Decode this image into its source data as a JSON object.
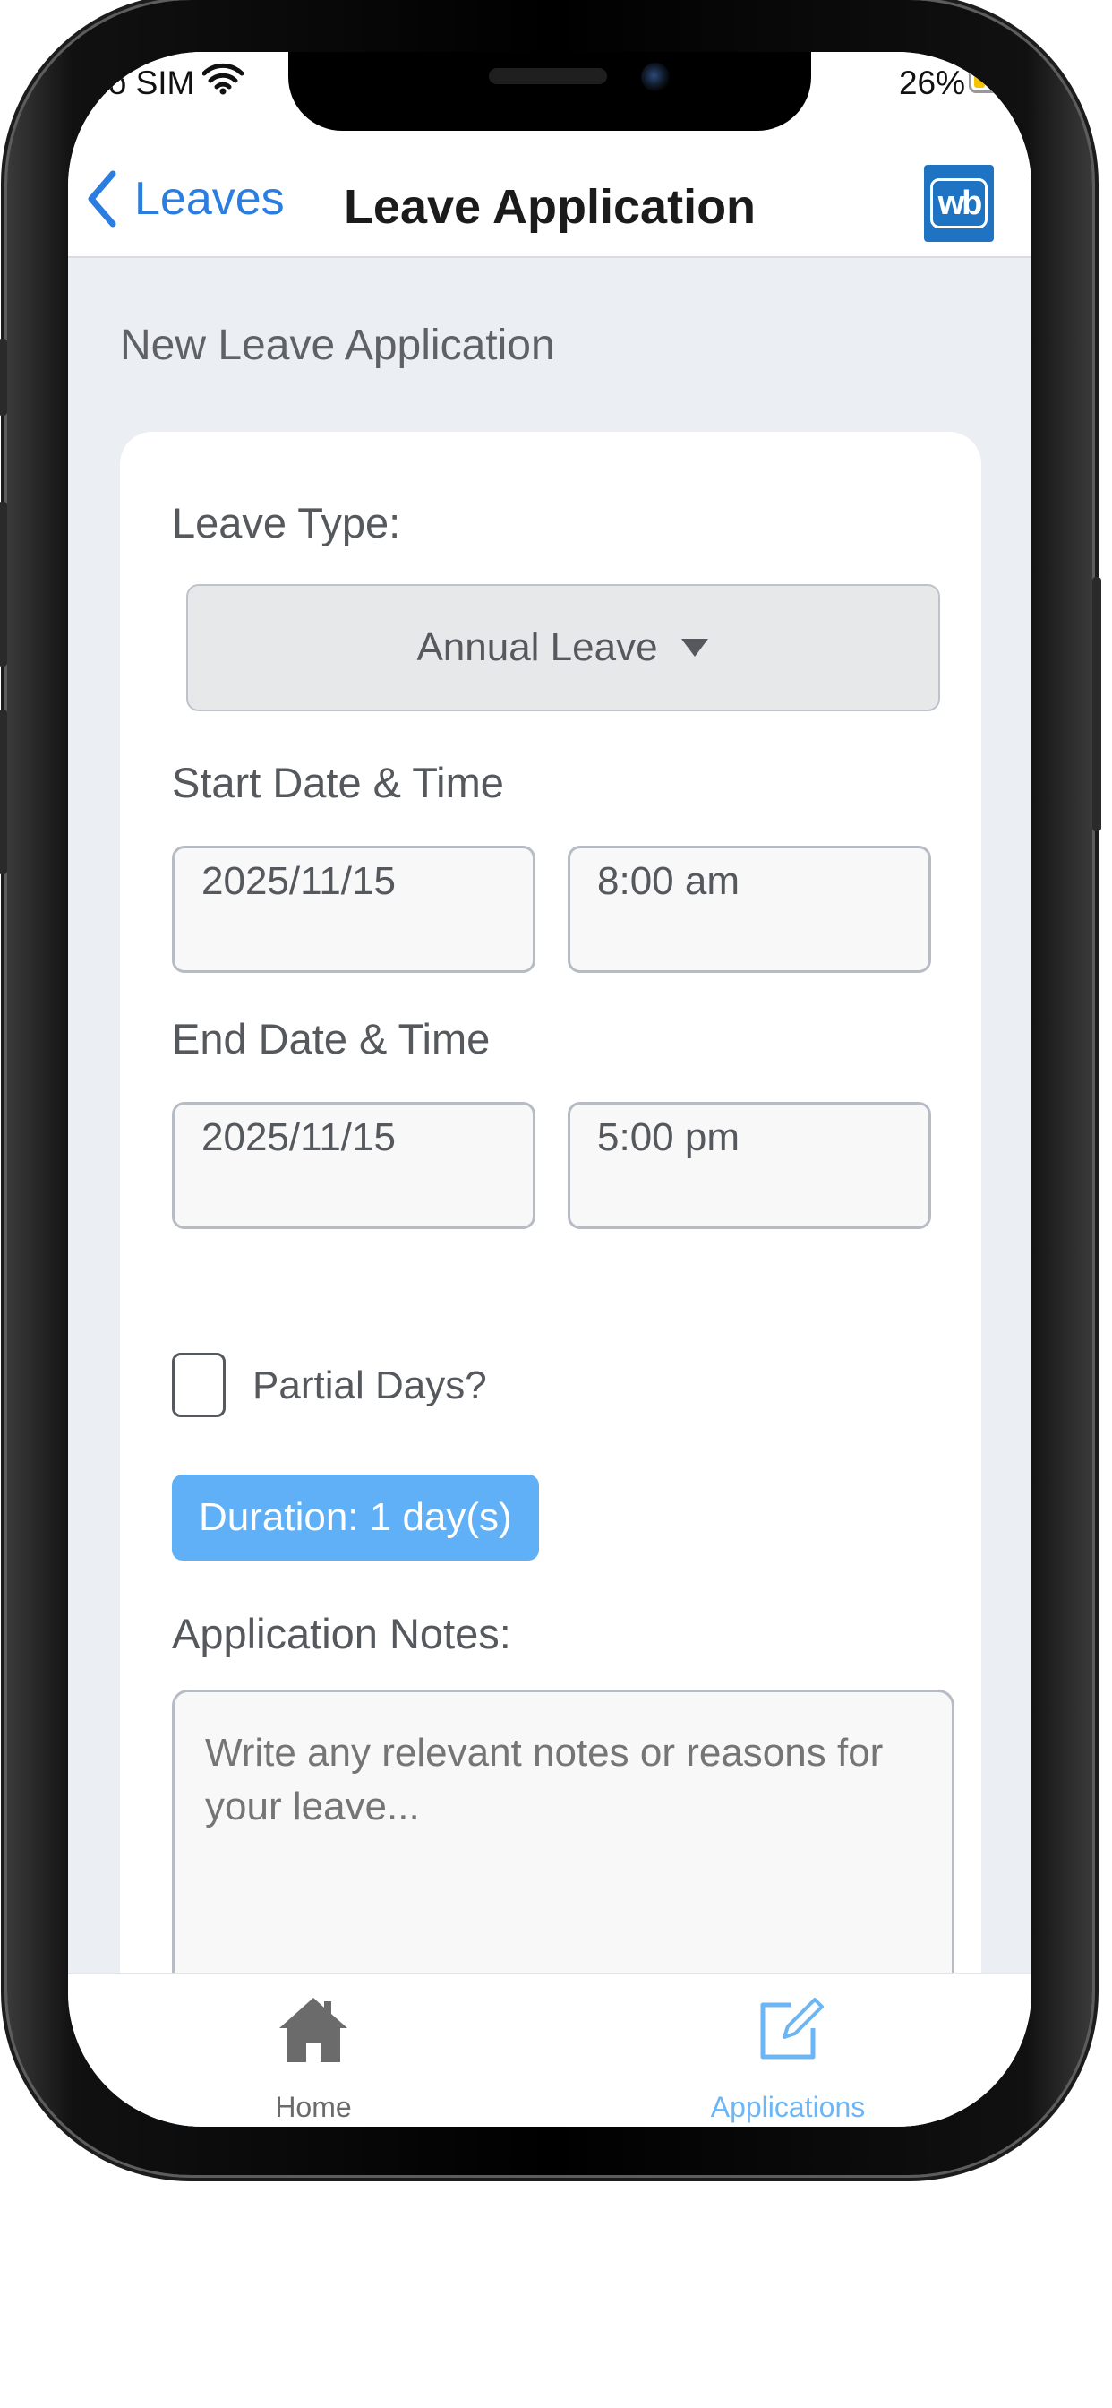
{
  "status_bar": {
    "carrier": "No SIM",
    "battery_percent": "26%"
  },
  "nav": {
    "back_label": "Leaves",
    "title": "Leave Application",
    "logo_text": "wb"
  },
  "form": {
    "section_title": "New Leave Application",
    "leave_type_label": "Leave Type:",
    "leave_type_value": "Annual Leave",
    "start_label": "Start Date & Time",
    "start_date": "2025/11/15",
    "start_time": "8:00 am",
    "end_label": "End Date & Time",
    "end_date": "2025/11/15",
    "end_time": "5:00 pm",
    "partial_days_label": "Partial Days?",
    "partial_days_checked": false,
    "duration": "Duration: 1 day(s)",
    "notes_label": "Application Notes:",
    "notes_placeholder": "Write any relevant notes or reasons for your leave..."
  },
  "tabbar": {
    "items": [
      {
        "label": "Home",
        "icon": "house-icon",
        "active": false
      },
      {
        "label": "Applications",
        "icon": "edit-square-icon",
        "active": true
      }
    ]
  },
  "colors": {
    "accent": "#2b7de0",
    "duration_badge": "#5fb0f7",
    "active_tab": "#6cb6f5",
    "submit_button": "#3aa4ee",
    "logo": "#1e73c2"
  }
}
